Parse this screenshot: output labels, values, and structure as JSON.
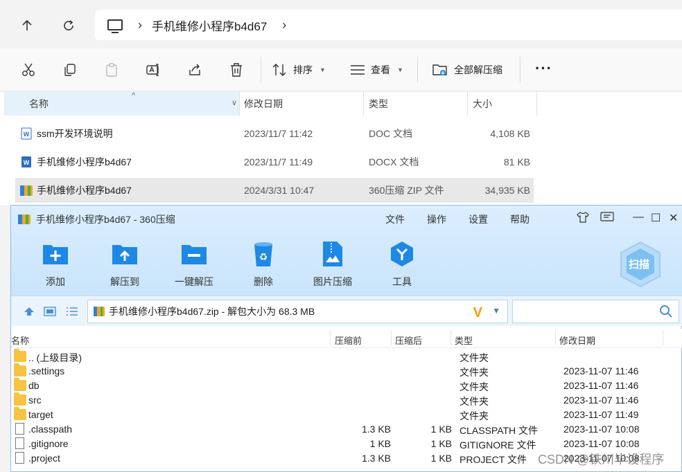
{
  "explorer": {
    "breadcrumb": "手机维修小程序b4d67",
    "toolbar": {
      "sort_label": "排序",
      "view_label": "查看",
      "extract_all_label": "全部解压缩"
    },
    "columns": {
      "name": "名称",
      "modified": "修改日期",
      "type": "类型",
      "size": "大小"
    },
    "files": [
      {
        "name": "ssm开发环境说明",
        "modified": "2023/11/7 11:42",
        "type": "DOC 文档",
        "size": "4,108 KB",
        "icon": "word-doc-icon"
      },
      {
        "name": "手机维修小程序b4d67",
        "modified": "2023/11/7 11:49",
        "type": "DOCX 文档",
        "size": "81 KB",
        "icon": "word-docx-icon"
      },
      {
        "name": "手机维修小程序b4d67",
        "modified": "2024/3/31 10:47",
        "type": "360压缩 ZIP 文件",
        "size": "34,935 KB",
        "icon": "zip-archive-icon"
      }
    ]
  },
  "zip": {
    "title": "手机维修小程序b4d67 - 360压缩",
    "menu": {
      "file": "文件",
      "ops": "操作",
      "settings": "设置",
      "help": "帮助"
    },
    "buttons": {
      "add": "添加",
      "extract_to": "解压到",
      "one_click": "一键解压",
      "delete": "删除",
      "img_compress": "图片压缩",
      "tools": "工具"
    },
    "scan_label": "扫描",
    "path": "手机维修小程序b4d67.zip - 解包大小为 68.3 MB",
    "columns": {
      "name": "名称",
      "compressed_before": "压缩前",
      "compressed_after": "压缩后",
      "type": "类型",
      "modified": "修改日期"
    },
    "entries": [
      {
        "name": ".. (上级目录)",
        "before": "",
        "after": "",
        "type": "文件夹",
        "modified": "",
        "kind": "folder"
      },
      {
        "name": ".settings",
        "before": "",
        "after": "",
        "type": "文件夹",
        "modified": "2023-11-07 11:46",
        "kind": "folder"
      },
      {
        "name": "db",
        "before": "",
        "after": "",
        "type": "文件夹",
        "modified": "2023-11-07 11:46",
        "kind": "folder"
      },
      {
        "name": "src",
        "before": "",
        "after": "",
        "type": "文件夹",
        "modified": "2023-11-07 11:46",
        "kind": "folder"
      },
      {
        "name": "target",
        "before": "",
        "after": "",
        "type": "文件夹",
        "modified": "2023-11-07 11:49",
        "kind": "folder"
      },
      {
        "name": ".classpath",
        "before": "1.3 KB",
        "after": "1 KB",
        "type": "CLASSPATH 文件",
        "modified": "2023-11-07 10:08",
        "kind": "file"
      },
      {
        "name": ".gitignore",
        "before": "1 KB",
        "after": "1 KB",
        "type": "GITIGNORE 文件",
        "modified": "2023-11-07 10:08",
        "kind": "file"
      },
      {
        "name": ".project",
        "before": "1.3 KB",
        "after": "1 KB",
        "type": "PROJECT 文件",
        "modified": "2023-11-07 10:08",
        "kind": "file"
      }
    ]
  },
  "watermark": "CSDN @铁川毕设程序",
  "colors": {
    "accent_blue": "#1e88e5",
    "folder_yellow": "#f6c342",
    "selection": "#e8e8e8"
  }
}
